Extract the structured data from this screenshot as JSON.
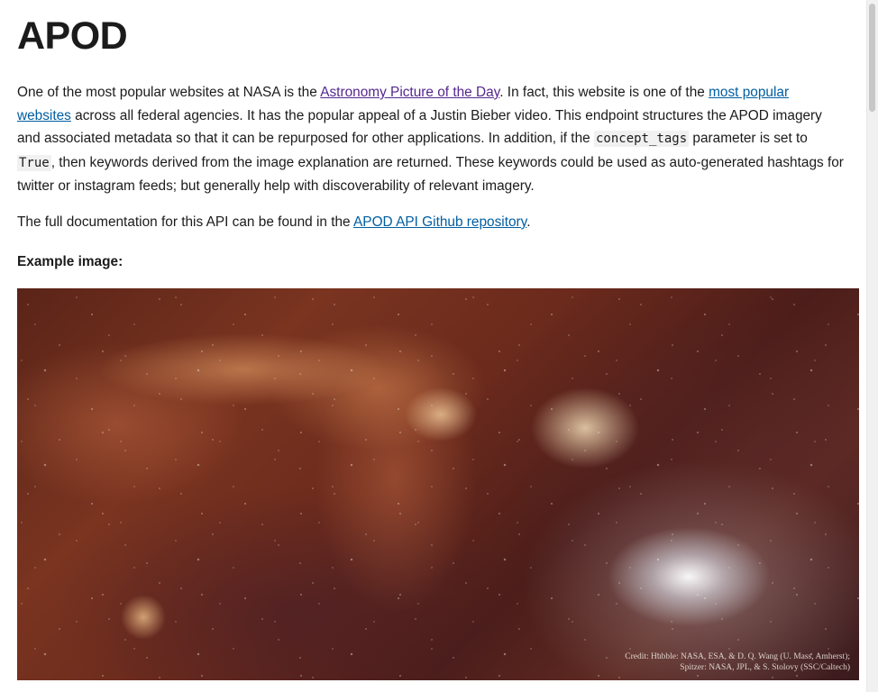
{
  "page": {
    "title": "APOD",
    "intro": {
      "t1": "One of the most popular websites at NASA is the ",
      "link_apod": "Astronomy Picture of the Day",
      "t2": ". In fact, this website is one of the ",
      "link_popular": "most popular websites",
      "t3": " across all federal agencies. It has the popular appeal of a Justin Bieber video. This endpoint structures the APOD imagery and associated metadata so that it can be repurposed for other applications. In addition, if the ",
      "code_param": "concept_tags",
      "t4": " parameter is set to ",
      "code_value": "True",
      "t5": ", then keywords derived from the image explanation are returned. These keywords could be used as auto-generated hashtags for twitter or instagram feeds; but generally help with discoverability of relevant imagery."
    },
    "docs": {
      "t1": "The full documentation for this API can be found in the ",
      "link_repo": "APOD API Github repository",
      "t2": "."
    },
    "example_label": "Example image:",
    "image_credit": {
      "line1": "Credit: Hubble: NASA, ESA, & D. Q. Wang (U. Mass, Amherst);",
      "line2": "Spitzer: NASA, JPL, & S. Stolovy (SSC/Caltech)"
    }
  },
  "colors": {
    "link": "#005ea2",
    "link_visited": "#54278f",
    "text": "#1b1b1b"
  }
}
